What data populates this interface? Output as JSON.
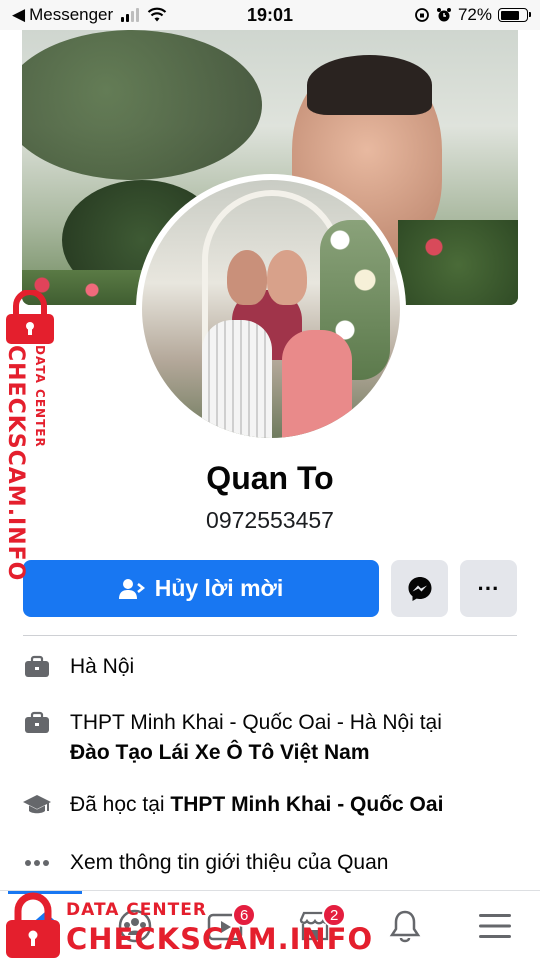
{
  "status_bar": {
    "back_app": "Messenger",
    "time": "19:01",
    "battery_percent": "72%",
    "battery_level": 0.72,
    "signal_bars_filled": 2
  },
  "profile": {
    "name": "Quan To",
    "subtitle": "0972553457"
  },
  "actions": {
    "primary_label": "Hủy lời mời",
    "messenger_icon": "messenger-icon",
    "more_label": "···"
  },
  "intro": [
    {
      "icon": "briefcase-icon",
      "text": "Hà Nội"
    },
    {
      "icon": "briefcase-icon",
      "text_prefix": "THPT Minh Khai - Quốc Oai - Hà Nội tại",
      "text_bold": "Đào Tạo Lái Xe Ô Tô Việt Nam"
    },
    {
      "icon": "graduation-cap-icon",
      "text_prefix": "Đã học tại",
      "text_bold": "THPT Minh Khai - Quốc Oai"
    },
    {
      "icon": "more-dots-icon",
      "text": "Xem thông tin giới thiệu của Quan"
    }
  ],
  "tabbar": {
    "tabs": [
      {
        "name": "home",
        "icon": "home-icon",
        "active": true
      },
      {
        "name": "groups",
        "icon": "groups-icon"
      },
      {
        "name": "watch",
        "icon": "video-icon",
        "badge": "6"
      },
      {
        "name": "marketplace",
        "icon": "marketplace-icon",
        "badge": "2"
      },
      {
        "name": "notifications",
        "icon": "bell-icon"
      },
      {
        "name": "menu",
        "icon": "menu-icon"
      }
    ]
  },
  "watermark": {
    "small": "DATA CENTER",
    "large": "CHECKSCAM.INFO",
    "color": "#e41f2d"
  },
  "colors": {
    "accent": "#1877f2",
    "badge": "#e41e3f",
    "secondary_button": "#e4e6eb"
  }
}
